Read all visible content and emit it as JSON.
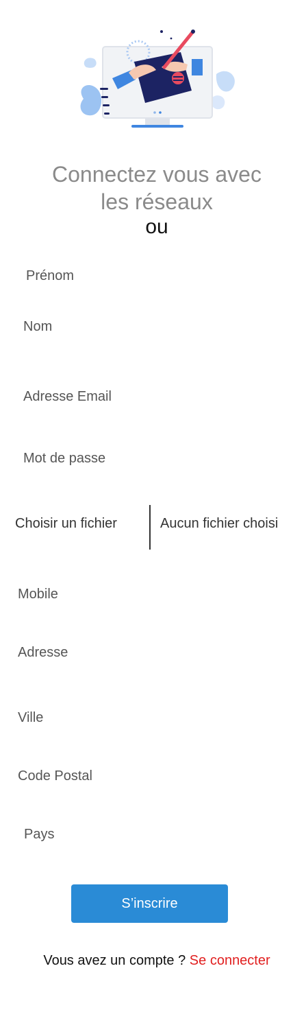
{
  "heading": {
    "line1": "Connectez vous avec",
    "line2": "les réseaux",
    "or": "ou"
  },
  "form": {
    "first_name_placeholder": "Prénom",
    "last_name_placeholder": "Nom",
    "email_placeholder": "Adresse Email",
    "password_placeholder": "Mot de passe",
    "file_button_label": "Choisir un fichier",
    "file_status": "Aucun fichier choisi",
    "mobile_placeholder": "Mobile",
    "address_placeholder": "Adresse",
    "city_placeholder": "Ville",
    "postal_code_placeholder": "Code Postal",
    "country_placeholder": "Pays",
    "submit_label": "S’inscrire"
  },
  "footer": {
    "prompt": "Vous avez un compte ? ",
    "login_link": "Se connecter"
  },
  "colors": {
    "primary_button": "#2a8bd6",
    "link": "#e11f1f",
    "heading": "#8a8a8a"
  }
}
